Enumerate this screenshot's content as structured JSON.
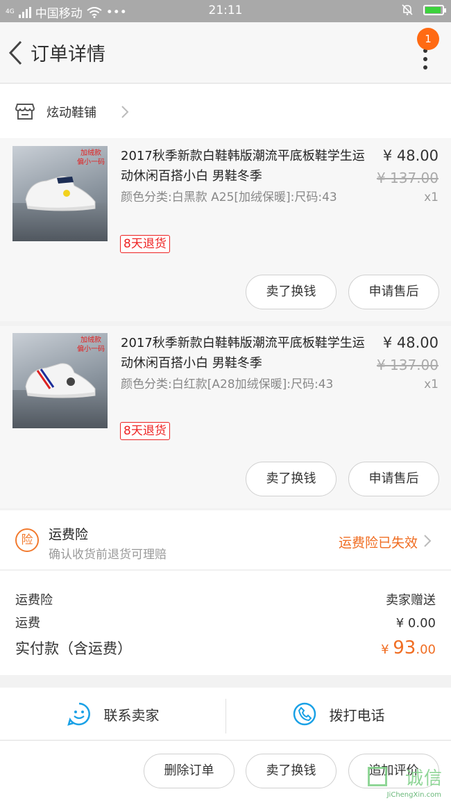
{
  "status_bar": {
    "carrier": "中国移动",
    "net": "4G",
    "dots": "•••",
    "time": "21:11"
  },
  "nav": {
    "title": "订单详情",
    "badge": "1"
  },
  "shop": {
    "name": "炫动鞋铺"
  },
  "items": [
    {
      "title": "2017秋季新款白鞋韩版潮流平底板鞋学生运动休闲百搭小白 男鞋冬季",
      "spec": "颜色分类:白黑款 A25[加绒保暖]:尺码:43",
      "return_tag": "8天退货",
      "price": "¥ 48.00",
      "original_price": "¥ 137.00",
      "qty": "x1",
      "thumb_tag": "加绒款\n偏小一码",
      "sell_button": "卖了换钱",
      "aftersale_button": "申请售后"
    },
    {
      "title": "2017秋季新款白鞋韩版潮流平底板鞋学生运动休闲百搭小白 男鞋冬季",
      "spec": "颜色分类:白红款[A28加绒保暖]:尺码:43",
      "return_tag": "8天退货",
      "price": "¥ 48.00",
      "original_price": "¥ 137.00",
      "qty": "x1",
      "thumb_tag": "加绒款\n偏小一码",
      "sell_button": "卖了换钱",
      "aftersale_button": "申请售后"
    }
  ],
  "insurance": {
    "badge": "险",
    "title": "运费险",
    "subtitle": "确认收货前退货可理赔",
    "status": "运费险已失效"
  },
  "summary": {
    "ins_label": "运费险",
    "ins_value": "卖家赠送",
    "shipping_label": "运费",
    "shipping_value": "¥ 0.00",
    "paid_label": "实付款（含运费）",
    "paid_currency": "¥",
    "paid_int": "93",
    "paid_dec": ".00"
  },
  "contact": {
    "seller": "联系卖家",
    "call": "拨打电话"
  },
  "actions": {
    "delete": "删除订单",
    "sell": "卖了换钱",
    "review": "追加评价"
  },
  "watermark": {
    "cn": "诚信",
    "en": "JiChengXin.com"
  },
  "colors": {
    "accent": "#f06d22",
    "icon_blue": "#1aa1e6",
    "return_red": "#e22222"
  }
}
